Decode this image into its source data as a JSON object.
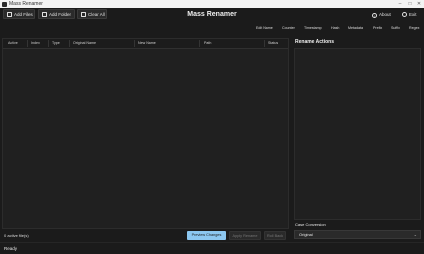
{
  "window": {
    "title": "Mass Renamer",
    "controls": [
      "–",
      "□",
      "✕"
    ]
  },
  "toolbar": {
    "add_files": "Add Files",
    "add_folder": "Add Folder",
    "clear_all": "Clear All",
    "app_title": "Mass Renamer",
    "about": "About",
    "exit": "Exit"
  },
  "tabs": [
    "Edit Name",
    "Counter",
    "Timestamp",
    "Hash",
    "Metadata",
    "Prefix",
    "Suffix",
    "Regex"
  ],
  "table": {
    "columns": [
      "Active",
      "Index",
      "Type",
      "Original Name",
      "New Name",
      "Path",
      "Status"
    ]
  },
  "footer": {
    "active_count": "0",
    "active_label": "active file(s)",
    "preview": "Preview Changes",
    "apply": "Apply Rename",
    "rollback": "Roll Back"
  },
  "actions": {
    "title": "Rename Actions",
    "case_label": "Case Conversion",
    "case_value": "Original"
  },
  "status": {
    "text": "Ready"
  },
  "colors": {
    "accent": "#8cc7f0",
    "background": "#1b1b1b",
    "panel": "#202020"
  }
}
